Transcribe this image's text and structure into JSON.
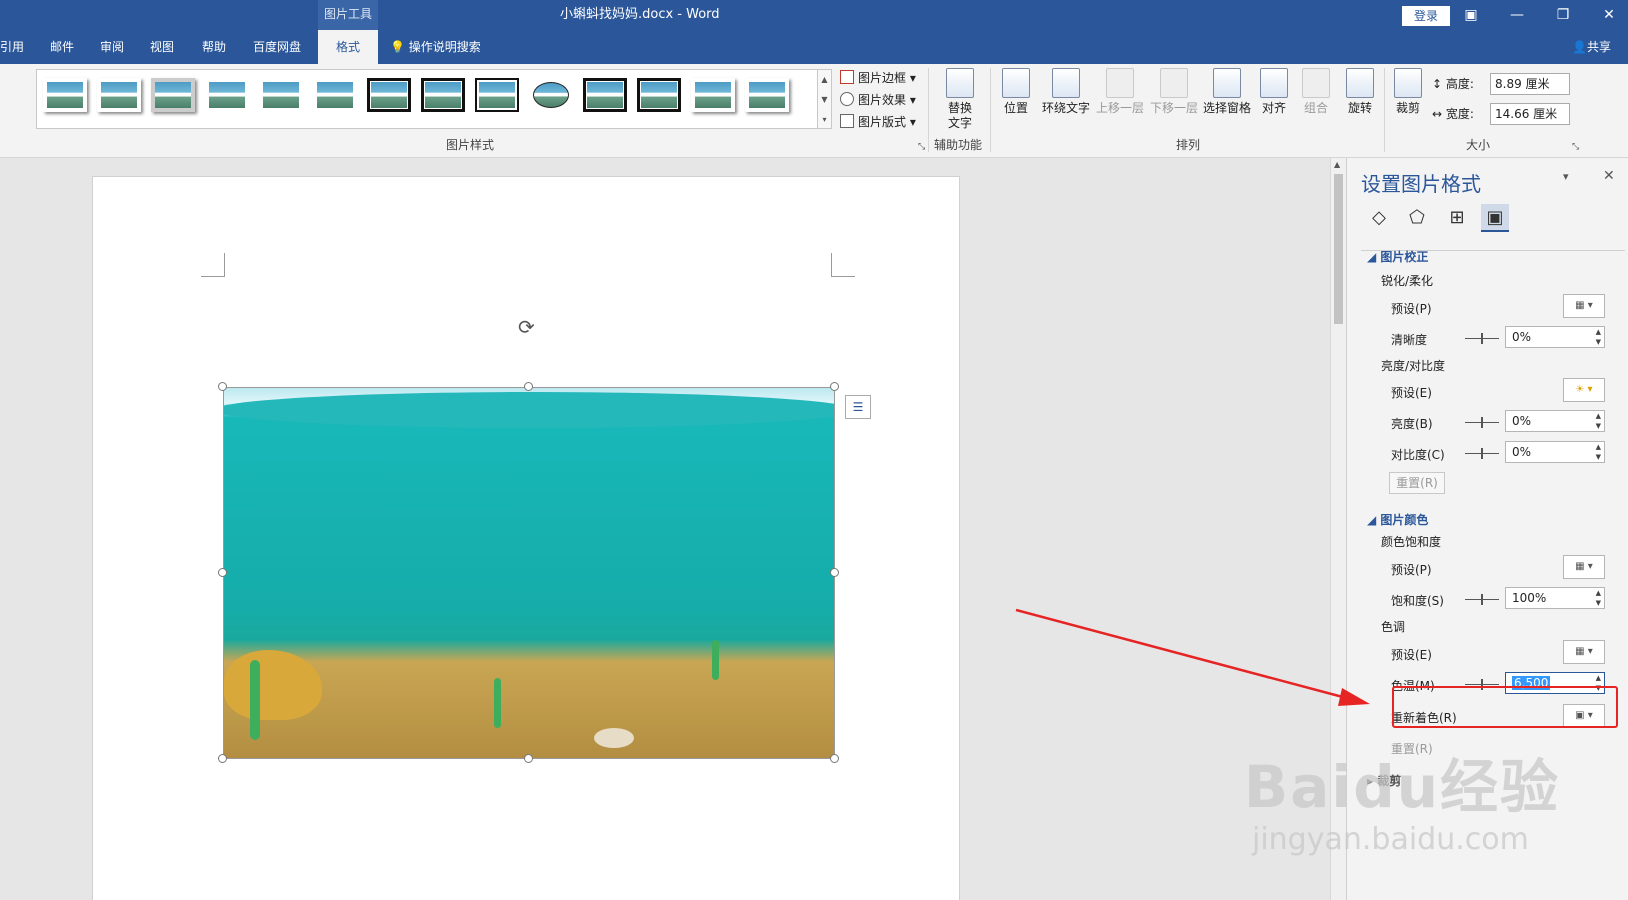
{
  "titlebar": {
    "context_tool": "图片工具",
    "doc_title": "小蝌蚪找妈妈.docx - Word",
    "login": "登录",
    "ribbon_display": "▣",
    "minimize": "—",
    "restore": "❐",
    "close": "✕"
  },
  "tabs": {
    "items": [
      "引用",
      "邮件",
      "审阅",
      "视图",
      "帮助",
      "百度网盘",
      "格式"
    ],
    "tellme": "操作说明搜索",
    "share": "共享"
  },
  "ribbon": {
    "picture_styles_label": "图片样式",
    "border": "图片边框",
    "effects": "图片效果",
    "layout": "图片版式",
    "alt_text": [
      "替换",
      "文字"
    ],
    "accessibility_label": "辅助功能",
    "position": "位置",
    "wrap": "环绕文字",
    "bring_forward": "上移一层",
    "send_backward": "下移一层",
    "selection_pane": "选择窗格",
    "align": "对齐",
    "group": "组合",
    "rotate": "旋转",
    "arrange_label": "排列",
    "crop": "裁剪",
    "height_label": "高度:",
    "height_value": "8.89 厘米",
    "width_label": "宽度:",
    "width_value": "14.66 厘米",
    "size_label": "大小"
  },
  "pane": {
    "title": "设置图片格式",
    "section_correction": "图片校正",
    "sharpen_soften": "锐化/柔化",
    "preset_p": "预设(P)",
    "sharpness": "清晰度",
    "sharpness_value": "0%",
    "brightness_contrast": "亮度/对比度",
    "preset_e": "预设(E)",
    "brightness": "亮度(B)",
    "brightness_value": "0%",
    "contrast": "对比度(C)",
    "contrast_value": "0%",
    "reset": "重置(R)",
    "section_color": "图片颜色",
    "saturation_title": "颜色饱和度",
    "preset_p2": "预设(P)",
    "saturation": "饱和度(S)",
    "saturation_value": "100%",
    "tone_title": "色调",
    "preset_e2": "预设(E)",
    "temperature": "色温(M)",
    "temperature_value": "6,500",
    "recolor": "重新着色(R)",
    "reset2": "重置(R)",
    "crop": "裁剪"
  },
  "watermark": {
    "main": "Baidu经验",
    "sub": "jingyan.baidu.com"
  },
  "colors": {
    "accent": "#2b579a",
    "highlight": "#e62424"
  }
}
